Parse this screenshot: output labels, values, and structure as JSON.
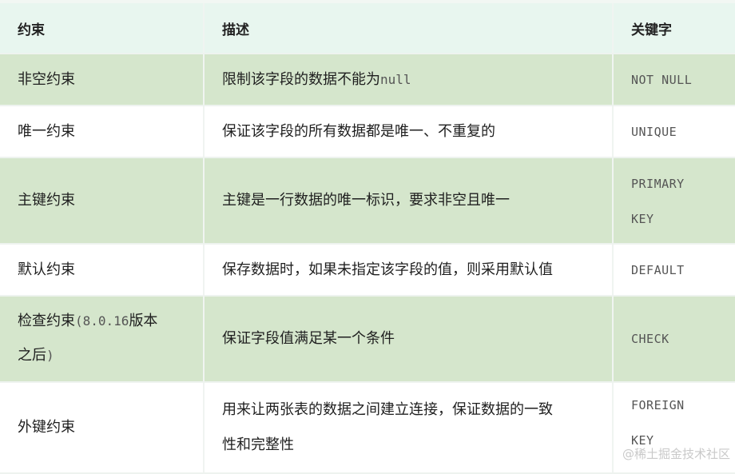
{
  "header": {
    "col_constraint": "约束",
    "col_description": "描述",
    "col_keyword": "关键字"
  },
  "rows": [
    {
      "constraint": "非空约束",
      "description": "限制该字段的数据不能为",
      "description_code": "null",
      "keyword": "NOT NULL"
    },
    {
      "constraint": "唯一约束",
      "description": "保证该字段的所有数据都是唯一、不重复的",
      "keyword": "UNIQUE"
    },
    {
      "constraint": "主键约束",
      "description": "主键是一行数据的唯一标识，要求非空且唯一",
      "keyword_line1": "PRIMARY",
      "keyword_line2": "KEY"
    },
    {
      "constraint": "默认约束",
      "description": "保存数据时，如果未指定该字段的值，则采用默认值",
      "keyword": "DEFAULT"
    },
    {
      "constraint_part1": "检查约束",
      "constraint_code": "(8.0.16",
      "constraint_part2": "版本",
      "constraint_part3": "之后",
      "constraint_code2": ")",
      "description": "保证字段值满足某一个条件",
      "keyword": "CHECK"
    },
    {
      "constraint": "外键约束",
      "description_line1": "用来让两张表的数据之间建立连接，保证数据的一致",
      "description_line2": "性和完整性",
      "keyword_line1": "FOREIGN",
      "keyword_line2": "KEY"
    }
  ],
  "watermark": "@稀土掘金技术社区"
}
